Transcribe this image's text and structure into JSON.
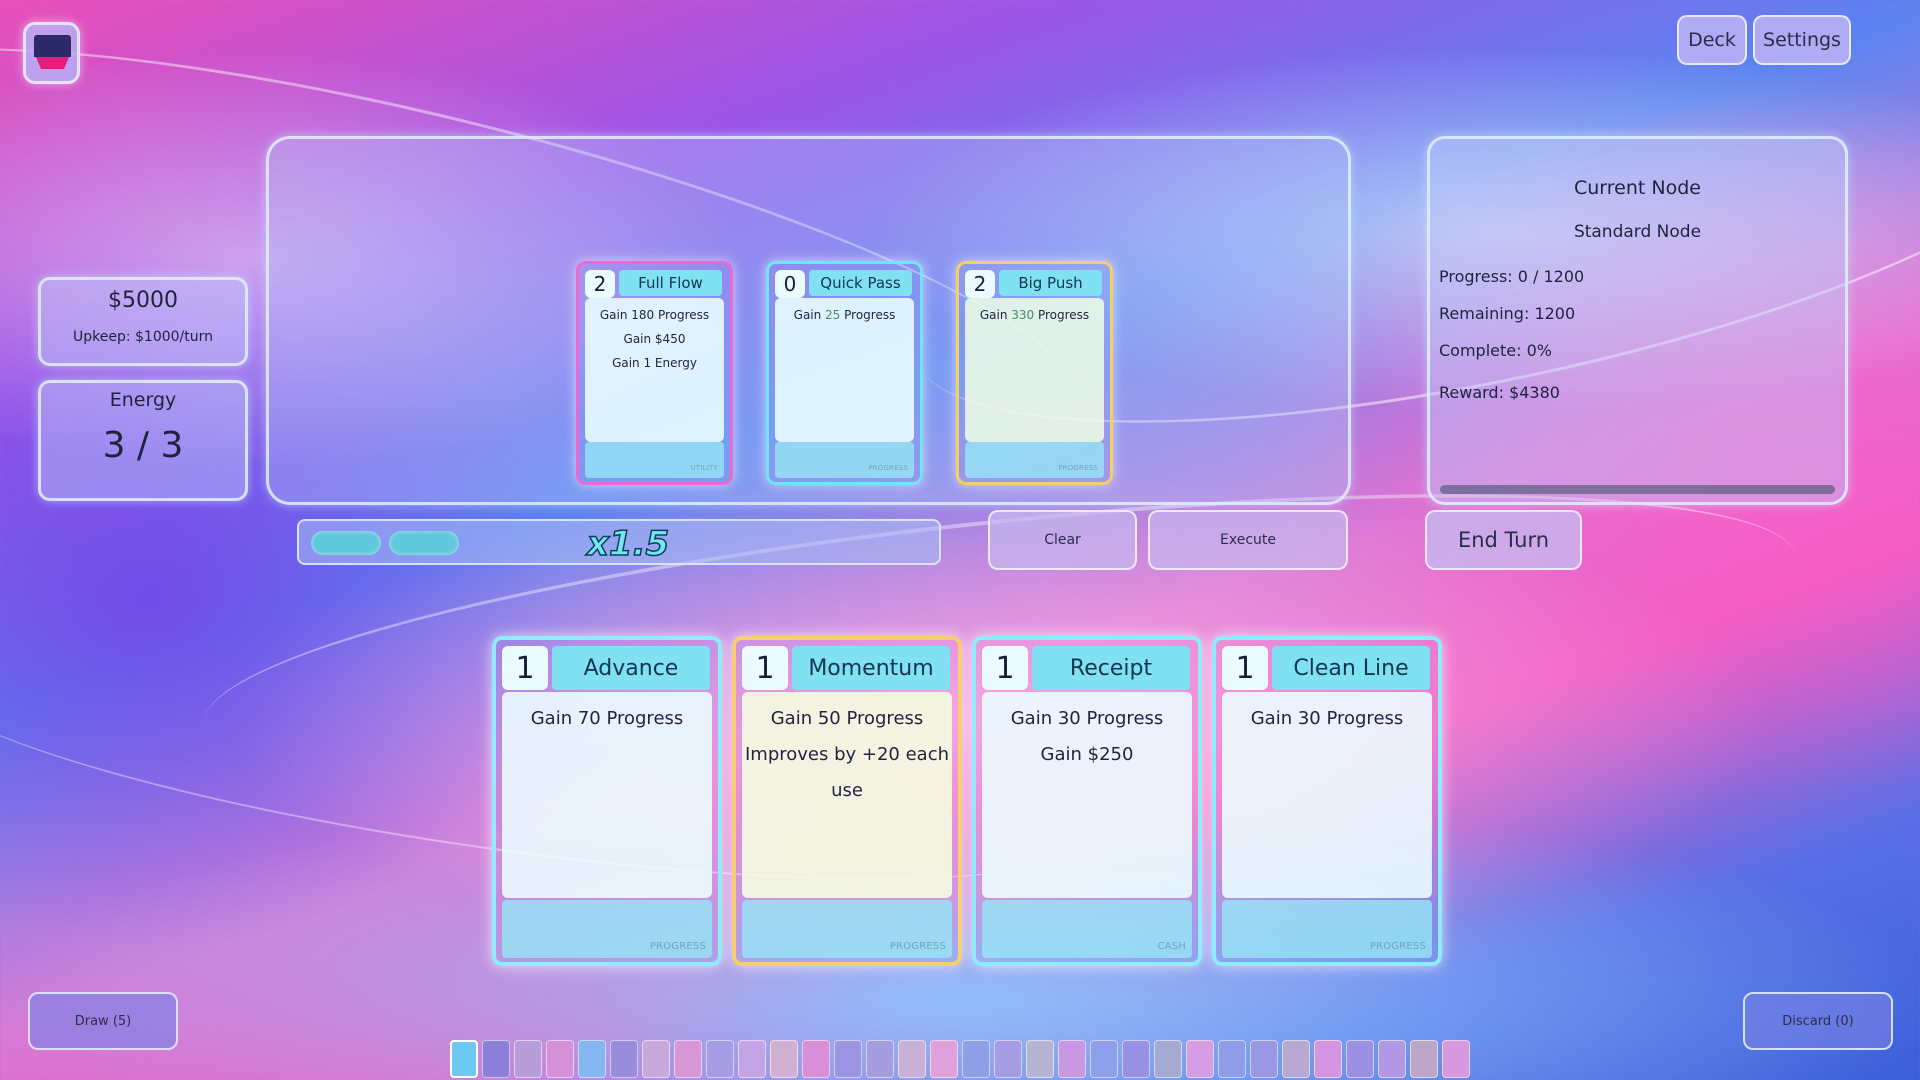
{
  "top_bar": {
    "deck_label": "Deck",
    "settings_label": "Settings"
  },
  "resources": {
    "money": "$5000",
    "upkeep": "Upkeep: $1000/turn",
    "energy_label": "Energy",
    "energy_value": "3 / 3"
  },
  "play_zone": {
    "cards": [
      {
        "cost": "2",
        "title": "Full Flow",
        "lines": [
          "Gain 180 Progress",
          "Gain $450",
          "Gain 1 Energy"
        ],
        "footer": "UTILITY",
        "border_color": "#ee68d0"
      },
      {
        "cost": "0",
        "title": "Quick Pass",
        "line_prefix": "Gain ",
        "line_value": "25",
        "line_suffix": " Progress",
        "footer": "PROGRESS",
        "border_color": "#6fe6f6"
      },
      {
        "cost": "2",
        "title": "Big Push",
        "line_prefix": "Gain ",
        "line_value": "330",
        "line_suffix": " Progress",
        "footer": "PROGRESS",
        "border_color": "#f6d064"
      }
    ]
  },
  "multiplier": {
    "text": "x1.5",
    "pill_color": "#5fc8dc"
  },
  "actions": {
    "clear_label": "Clear",
    "execute_label": "Execute",
    "end_turn_label": "End Turn"
  },
  "node": {
    "title": "Current Node",
    "type": "Standard Node",
    "progress": "Progress: 0 / 1200",
    "remaining": "Remaining: 1200",
    "complete": "Complete: 0%",
    "reward": "Reward: $4380",
    "progress_fraction": 0
  },
  "hand": [
    {
      "cost": "1",
      "title": "Advance",
      "lines": [
        "Gain 70 Progress"
      ],
      "footer": "PROGRESS",
      "border_color": "#8fecfa"
    },
    {
      "cost": "1",
      "title": "Momentum",
      "lines": [
        "Gain 50 Progress",
        "Improves by +20 each",
        "use"
      ],
      "footer": "PROGRESS",
      "border_color": "#f6cf70"
    },
    {
      "cost": "1",
      "title": "Receipt",
      "lines": [
        "Gain 30 Progress",
        "Gain $250"
      ],
      "footer": "CASH",
      "border_color": "#8fecfa"
    },
    {
      "cost": "1",
      "title": "Clean Line",
      "lines": [
        "Gain 30 Progress"
      ],
      "footer": "PROGRESS",
      "border_color": "#8fecfa"
    }
  ],
  "piles": {
    "draw_label": "Draw (5)",
    "discard_label": "Discard (0)"
  },
  "deck_strip_colors": [
    "#6cc8f4",
    "#8b7fd8",
    "#b89ed8",
    "#d690d8",
    "#86b6f0",
    "#9a8cdc",
    "#c8a8de",
    "#d898d8",
    "#a69ce6",
    "#c4a4e6",
    "#d2b0d4",
    "#d88ed8",
    "#9a94e2",
    "#a59cde",
    "#c8b0d8",
    "#e0a0dc",
    "#8f9ee6",
    "#a69ce6",
    "#b6b4d4",
    "#c898e4",
    "#8ea0ec",
    "#9890e4",
    "#a4aad4",
    "#d69ce4",
    "#8f9ce8",
    "#9a98e4",
    "#b8a8d4",
    "#d494e0",
    "#9c90e4",
    "#b198e4",
    "#bca6c8",
    "#d898e0"
  ],
  "icons": {
    "menu": "laptop-icon"
  }
}
